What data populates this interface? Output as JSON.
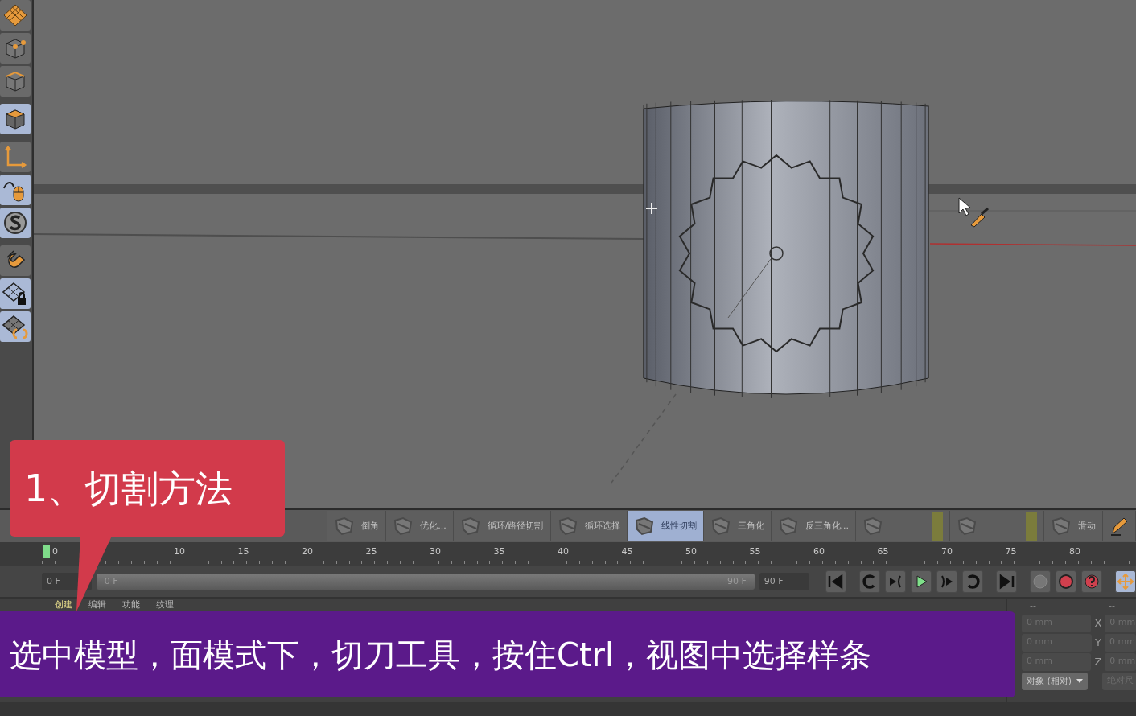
{
  "left_toolbar": [
    {
      "kind": "plane",
      "selected": false
    },
    {
      "kind": "points",
      "selected": false
    },
    {
      "kind": "edges",
      "selected": false
    },
    {
      "kind": "polygons",
      "selected": true
    },
    {
      "kind": "axis",
      "selected": false
    },
    {
      "kind": "mouse",
      "selected": true
    },
    {
      "kind": "snap",
      "selected": true
    },
    {
      "kind": "magnet",
      "selected": false
    },
    {
      "kind": "lock",
      "selected": true
    },
    {
      "kind": "workplane",
      "selected": true
    }
  ],
  "tool_strip": [
    {
      "label": "倒角",
      "selected": false
    },
    {
      "label": "优化...",
      "selected": false
    },
    {
      "label": "循环/路径切割",
      "selected": false
    },
    {
      "label": "循环选择",
      "selected": false
    },
    {
      "label": "线性切割",
      "selected": true
    },
    {
      "label": "三角化",
      "selected": false
    },
    {
      "label": "反三角化...",
      "selected": false
    },
    {
      "label": "滑动",
      "selected": false
    }
  ],
  "timeline": {
    "ticks": [
      "0",
      "10",
      "15",
      "20",
      "25",
      "30",
      "35",
      "40",
      "45",
      "50",
      "55",
      "60",
      "65",
      "70",
      "75",
      "80"
    ],
    "start_field": "0 F",
    "slider_start": "0 F",
    "slider_end": "90 F",
    "end_field": "90 F"
  },
  "bottom_tabs": [
    {
      "label": "创建",
      "selected": true
    },
    {
      "label": "编辑",
      "selected": false
    },
    {
      "label": "功能",
      "selected": false
    },
    {
      "label": "纹理",
      "selected": false
    }
  ],
  "coordinates": {
    "headers": [
      "--",
      "--"
    ],
    "rows": [
      {
        "axis": "X",
        "value": "0 mm",
        "value_2": "0 mm"
      },
      {
        "axis": "Y",
        "value": "0 mm",
        "value_2": "0 mm"
      },
      {
        "axis": "Z",
        "value": "0 mm",
        "value_2": "0 mm"
      }
    ],
    "mode": "对象 (相对)",
    "mode_2": "绝对尺"
  },
  "callout": "1、切割方法",
  "subtitle": "选中模型，面模式下，切刀工具，按住Ctrl，视图中选择样条"
}
